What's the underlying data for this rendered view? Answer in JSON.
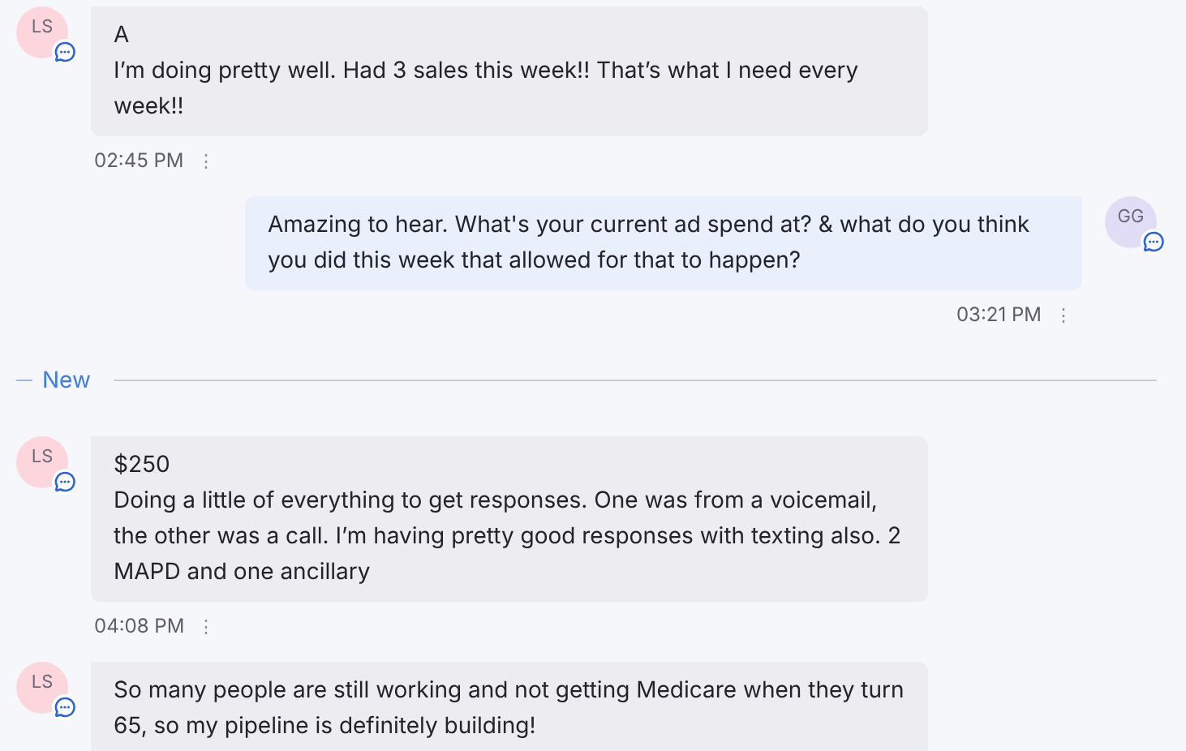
{
  "messages": [
    {
      "kind": "message",
      "outgoing": false,
      "initials": "LS",
      "paragraphs": [
        "A",
        "I’m doing pretty well. Had 3 sales this week!! That’s what I need every\nweek!!"
      ],
      "time": "02:45 PM",
      "menu": "⋮"
    },
    {
      "kind": "message",
      "outgoing": true,
      "initials": "GG",
      "paragraphs": [
        "Amazing to hear. What's your current ad spend at? & what do you think\nyou did this week that allowed for that to happen?"
      ],
      "time": "03:21 PM",
      "menu": "⋮"
    },
    {
      "kind": "divider",
      "label": "New"
    },
    {
      "kind": "message",
      "outgoing": false,
      "initials": "LS",
      "paragraphs": [
        "$250",
        "Doing a little of everything to get responses. One was from a voicemail,\nthe other was a call. I’m having pretty good responses with texting also. 2\nMAPD and one ancillary"
      ],
      "time": "04:08 PM",
      "menu": "⋮"
    },
    {
      "kind": "message",
      "outgoing": false,
      "initials": "LS",
      "paragraphs": [
        "So many people are still working and not getting Medicare when they turn\n65, so my pipeline is definitely building!"
      ]
    }
  ]
}
